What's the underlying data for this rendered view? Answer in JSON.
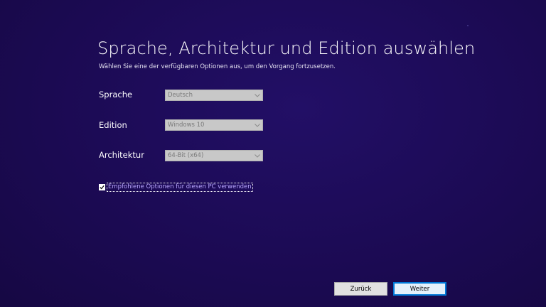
{
  "page": {
    "title": "Sprache, Architektur und Edition auswählen",
    "subtitle": "Wählen Sie eine der verfügbaren Optionen aus, um den Vorgang fortzusetzen."
  },
  "fields": {
    "language": {
      "label": "Sprache",
      "value": "Deutsch"
    },
    "edition": {
      "label": "Edition",
      "value": "Windows 10"
    },
    "architecture": {
      "label": "Architektur",
      "value": "64-Bit (x64)"
    }
  },
  "recommended": {
    "label": "Empfohlene Optionen für diesen PC verwenden",
    "checked": true
  },
  "buttons": {
    "back_label": "Zurück",
    "next_label": "Weiter"
  },
  "colors": {
    "background": "#1b0a52",
    "accent": "#0078d7",
    "link": "#b9a7ff"
  },
  "icons": {
    "dropdown": "chevron-down-icon",
    "check": "checkmark-icon"
  }
}
